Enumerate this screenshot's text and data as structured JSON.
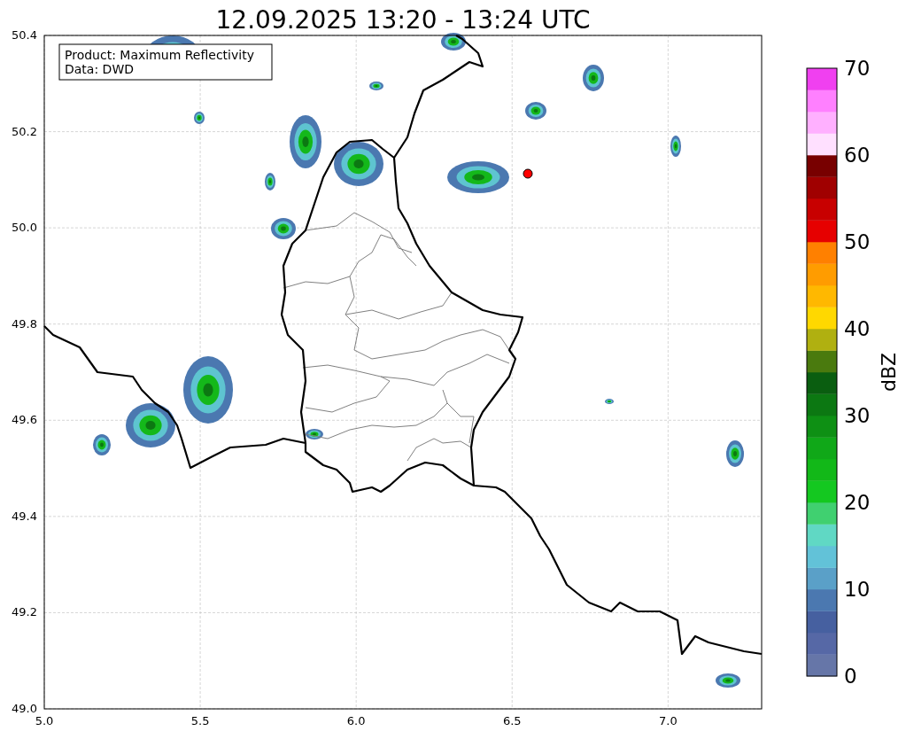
{
  "title": "12.09.2025 13:20 - 13:24 UTC",
  "legend": [
    "Product: Maximum Reflectivity",
    "Data: DWD"
  ],
  "map": {
    "x_ticks": [
      "5.0",
      "5.5",
      "6.0",
      "6.5",
      "7.0"
    ],
    "y_ticks": [
      "50.4",
      "50.2",
      "50.0",
      "49.8",
      "49.6",
      "49.4",
      "49.2",
      "49.0"
    ]
  },
  "colorbar": {
    "label": "dBZ",
    "ticks": [
      "70",
      "60",
      "50",
      "40",
      "30",
      "20",
      "10",
      "0"
    ],
    "bins": [
      {
        "color": "#6676a8"
      },
      {
        "color": "#5668a6"
      },
      {
        "color": "#4660a0"
      },
      {
        "color": "#4b78b0"
      },
      {
        "color": "#5aa0c8"
      },
      {
        "color": "#62c2d8"
      },
      {
        "color": "#60d8c4"
      },
      {
        "color": "#40d070"
      },
      {
        "color": "#14c820"
      },
      {
        "color": "#12b818"
      },
      {
        "color": "#10a818"
      },
      {
        "color": "#0e9014"
      },
      {
        "color": "#0c7812"
      },
      {
        "color": "#0a5e10"
      },
      {
        "color": "#4a7a0e"
      },
      {
        "color": "#b0b010"
      },
      {
        "color": "#ffd800"
      },
      {
        "color": "#ffb800"
      },
      {
        "color": "#ff9c00"
      },
      {
        "color": "#ff8000"
      },
      {
        "color": "#e60000"
      },
      {
        "color": "#c80000"
      },
      {
        "color": "#a00000"
      },
      {
        "color": "#780000"
      },
      {
        "color": "#ffe0ff"
      },
      {
        "color": "#ffb0ff"
      },
      {
        "color": "#ff80ff"
      },
      {
        "color": "#f040f0"
      }
    ]
  }
}
